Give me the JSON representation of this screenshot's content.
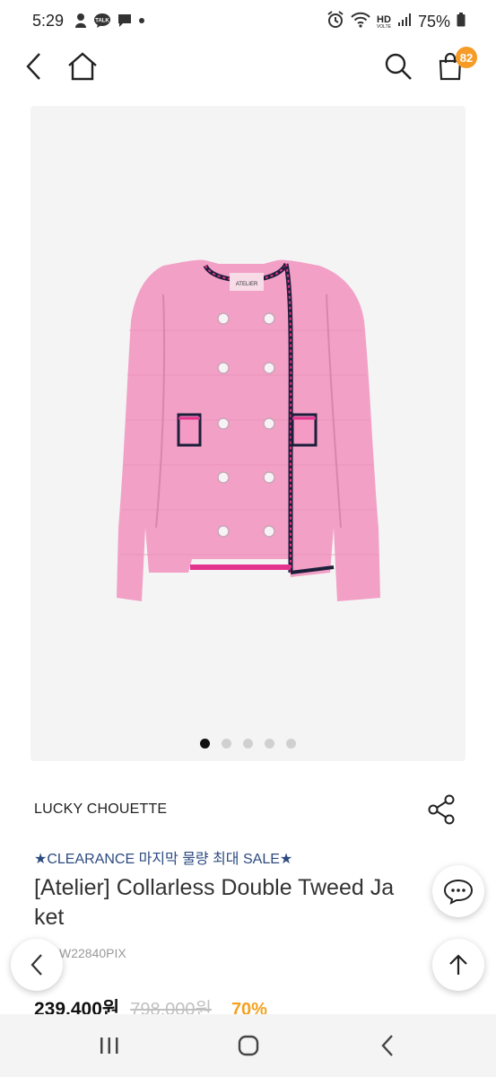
{
  "status_bar": {
    "time": "5:29",
    "talk_badge": "TALK",
    "network_label": "HD",
    "network_sublabel": "VOLTE",
    "battery": "75%"
  },
  "nav": {
    "cart_count": "82"
  },
  "gallery": {
    "label_text": "ATELIER",
    "dots_total": 5,
    "active_index": 0
  },
  "product": {
    "brand": "LUCKY CHOUETTE",
    "promo": "★CLEARANCE 마지막 물량 최대 SALE★",
    "title_line1": "[Atelier] Collarless Double Tweed Ja",
    "title_line2": "ket",
    "code": "W22840PIX",
    "price": "239,400원",
    "original_price": "798,000원",
    "discount": "70%"
  },
  "colors": {
    "accent_orange": "#f59b26",
    "promo_blue": "#2c4a80",
    "jacket_pink": "#f2a0c6"
  }
}
